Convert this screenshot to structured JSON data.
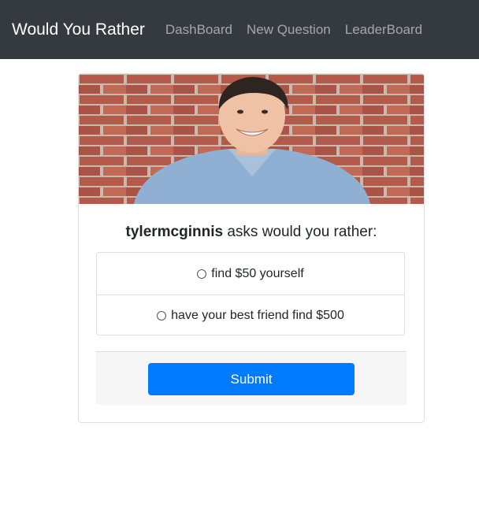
{
  "navbar": {
    "brand": "Would You Rather",
    "links": [
      "DashBoard",
      "New Question",
      "LeaderBoard"
    ]
  },
  "question": {
    "author": "tylermcginnis",
    "prompt_suffix": " asks would you rather:",
    "options": [
      "find $50 yourself",
      "have your best friend find $500"
    ]
  },
  "actions": {
    "submit_label": "Submit"
  },
  "colors": {
    "navbar_bg": "#343a40",
    "primary": "#007bff"
  }
}
